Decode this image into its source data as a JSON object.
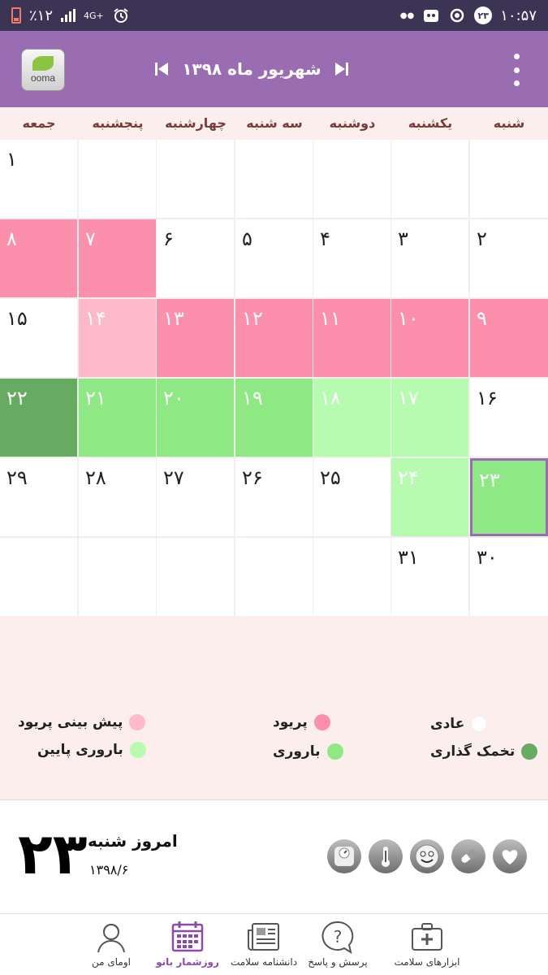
{
  "status_bar": {
    "time": "۱۰:۵۷",
    "battery": "٪۱۲",
    "network": "4G+",
    "notification_badge": "۲۳"
  },
  "header": {
    "logo_text": "ooma",
    "month_title": "شهریور ماه ۱۳۹۸"
  },
  "weekdays": [
    "شنبه",
    "یکشنبه",
    "دوشنبه",
    "سه شنبه",
    "چهارشنبه",
    "پنجشنبه",
    "جمعه"
  ],
  "calendar": {
    "days": [
      {
        "label": "۱",
        "status": "white"
      },
      {
        "label": "۲",
        "status": "white"
      },
      {
        "label": "۳",
        "status": "white"
      },
      {
        "label": "۴",
        "status": "white"
      },
      {
        "label": "۵",
        "status": "white"
      },
      {
        "label": "۶",
        "status": "white"
      },
      {
        "label": "۷",
        "status": "pink"
      },
      {
        "label": "۸",
        "status": "pink"
      },
      {
        "label": "۹",
        "status": "pink"
      },
      {
        "label": "۱۰",
        "status": "pink"
      },
      {
        "label": "۱۱",
        "status": "pink"
      },
      {
        "label": "۱۲",
        "status": "pink"
      },
      {
        "label": "۱۳",
        "status": "pink"
      },
      {
        "label": "۱۴",
        "status": "lpink"
      },
      {
        "label": "۱۵",
        "status": "white"
      },
      {
        "label": "۱۶",
        "status": "white"
      },
      {
        "label": "۱۷",
        "status": "lgreen"
      },
      {
        "label": "۱۸",
        "status": "lgreen"
      },
      {
        "label": "۱۹",
        "status": "green"
      },
      {
        "label": "۲۰",
        "status": "green"
      },
      {
        "label": "۲۱",
        "status": "green"
      },
      {
        "label": "۲۲",
        "status": "dgreen"
      },
      {
        "label": "۲۳",
        "status": "green",
        "today": true
      },
      {
        "label": "۲۴",
        "status": "lgreen"
      },
      {
        "label": "۲۵",
        "status": "white"
      },
      {
        "label": "۲۶",
        "status": "white"
      },
      {
        "label": "۲۷",
        "status": "white"
      },
      {
        "label": "۲۸",
        "status": "white"
      },
      {
        "label": "۲۹",
        "status": "white"
      },
      {
        "label": "۳۰",
        "status": "white"
      },
      {
        "label": "۳۱",
        "status": "white"
      }
    ]
  },
  "legend": {
    "normal": "عادی",
    "period": "پریود",
    "predicted_period": "پیش بینی پریود",
    "ovulation": "تخمک گذاری",
    "fertile": "باروری",
    "low_fertile": "باروری پایین",
    "colors": {
      "normal": "#ffffff",
      "period": "#fc90ac",
      "predicted_period": "#feb9cb",
      "ovulation": "#67ab63",
      "fertile": "#8ee985",
      "low_fertile": "#b6fbb0"
    }
  },
  "today": {
    "day_number": "۲۳",
    "label": "امروز شنبه",
    "date": "۱۳۹۸/۶"
  },
  "tools": [
    "heart-icon",
    "pill-icon",
    "mood-face-icon",
    "thermometer-icon",
    "weight-scale-icon"
  ],
  "bottom_nav": [
    {
      "label": "ابزارهای سلامت",
      "icon": "medical-kit-icon"
    },
    {
      "label": "پرسش و پاسخ",
      "icon": "question-bubble-icon"
    },
    {
      "label": "دانشنامه سلامت",
      "icon": "newspaper-icon"
    },
    {
      "label": "روزشمار بانو",
      "icon": "calendar-icon",
      "active": true
    },
    {
      "label": "اومای من",
      "icon": "profile-icon"
    }
  ]
}
